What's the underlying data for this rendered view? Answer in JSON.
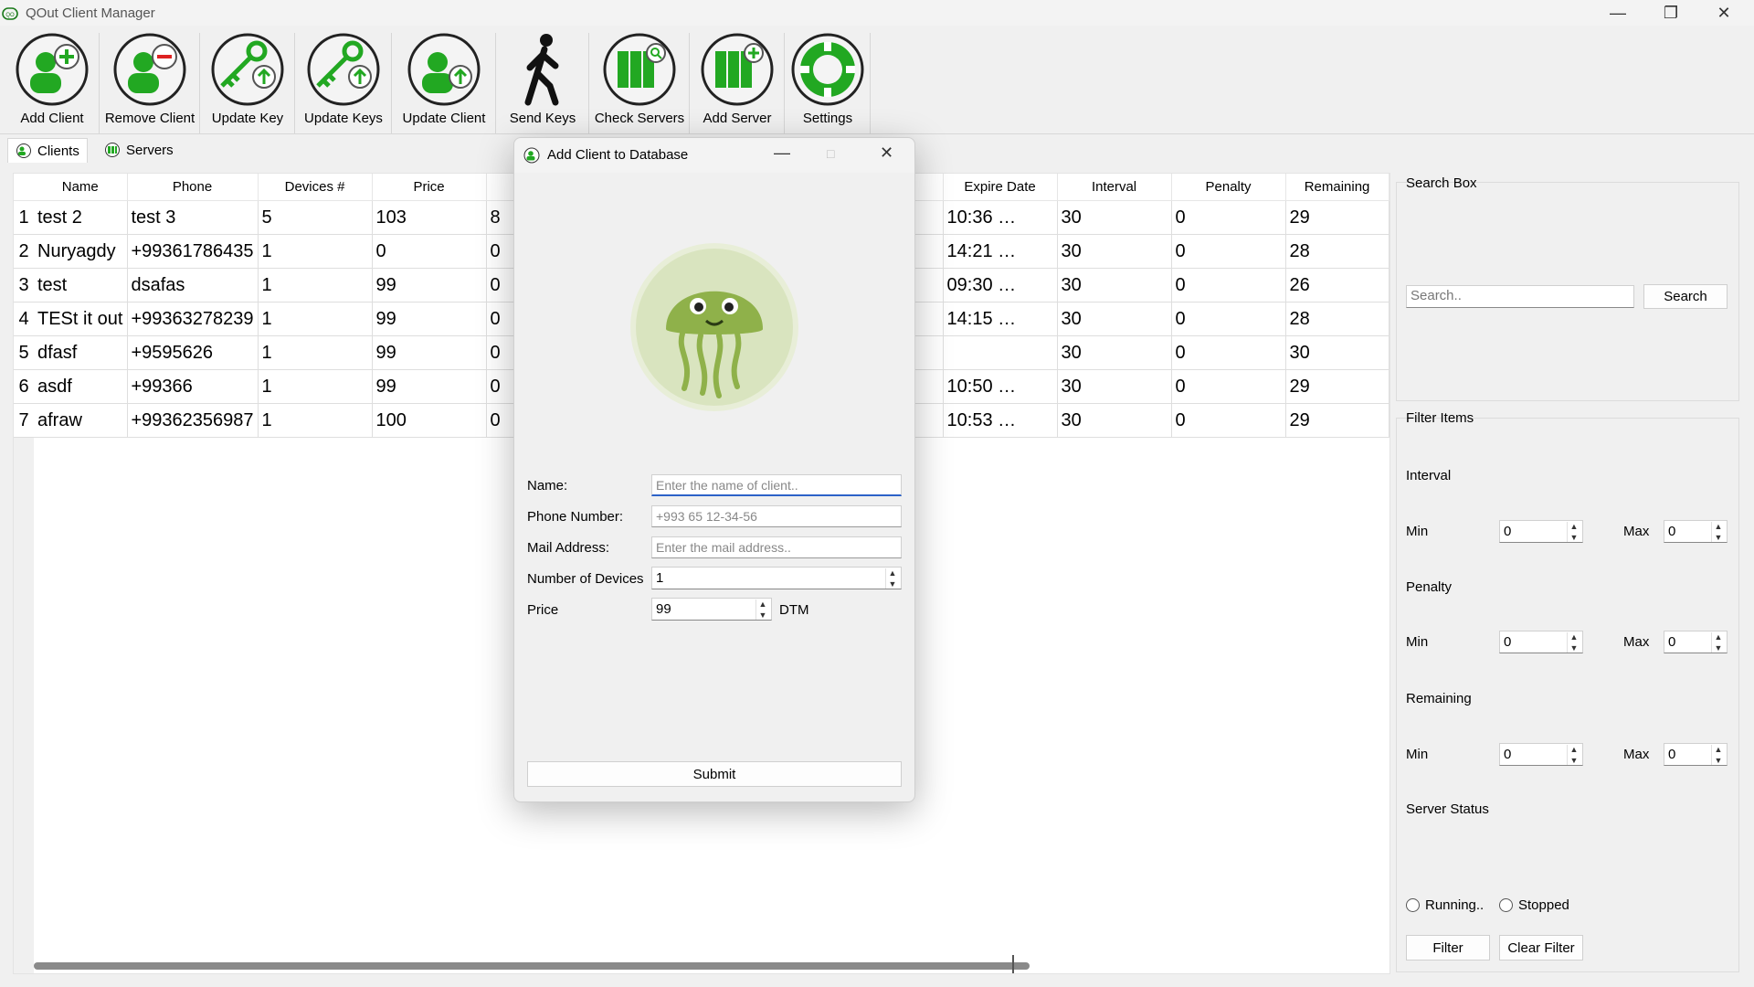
{
  "window": {
    "title": "QOut Client Manager"
  },
  "toolbar": [
    {
      "label": "Add Client",
      "icon": "add-client-icon"
    },
    {
      "label": "Remove Client",
      "icon": "remove-client-icon"
    },
    {
      "label": "Update Key",
      "icon": "update-key-icon"
    },
    {
      "label": "Update Keys",
      "icon": "update-keys-icon"
    },
    {
      "label": "Update Client",
      "icon": "update-client-icon"
    },
    {
      "label": "Send Keys",
      "icon": "walking-person-icon"
    },
    {
      "label": "Check Servers",
      "icon": "check-servers-icon"
    },
    {
      "label": "Add Server",
      "icon": "add-server-icon"
    },
    {
      "label": "Settings",
      "icon": "lifebuoy-icon"
    }
  ],
  "tabs": [
    {
      "label": "Clients",
      "active": true
    },
    {
      "label": "Servers",
      "active": false
    }
  ],
  "table": {
    "columns": [
      "Name",
      "Phone",
      "Devices #",
      "Price",
      "",
      "",
      "",
      "",
      "Expire Date",
      "Interval",
      "Penalty",
      "Remaining"
    ],
    "rows": [
      {
        "n": "1",
        "name": "test 2",
        "phone": "test 3",
        "devices": "5",
        "price": "103",
        "c5": "8",
        "expire": "10:36 …",
        "interval": "30",
        "penalty": "0",
        "remaining": "29"
      },
      {
        "n": "2",
        "name": "Nuryagdy",
        "phone": "+99361786435",
        "devices": "1",
        "price": "0",
        "c5": "0",
        "expire": "14:21 …",
        "interval": "30",
        "penalty": "0",
        "remaining": "28"
      },
      {
        "n": "3",
        "name": "test",
        "phone": "dsafas",
        "devices": "1",
        "price": "99",
        "c5": "0",
        "expire": "09:30 …",
        "interval": "30",
        "penalty": "0",
        "remaining": "26"
      },
      {
        "n": "4",
        "name": "TESt it out",
        "phone": "+99363278239",
        "devices": "1",
        "price": "99",
        "c5": "0",
        "expire": "14:15 …",
        "interval": "30",
        "penalty": "0",
        "remaining": "28"
      },
      {
        "n": "5",
        "name": "dfasf",
        "phone": "+9595626",
        "devices": "1",
        "price": "99",
        "c5": "0",
        "expire": "",
        "interval": "30",
        "penalty": "0",
        "remaining": "30"
      },
      {
        "n": "6",
        "name": "asdf",
        "phone": "+99366",
        "devices": "1",
        "price": "99",
        "c5": "0",
        "expire": "10:50 …",
        "interval": "30",
        "penalty": "0",
        "remaining": "29"
      },
      {
        "n": "7",
        "name": "afraw",
        "phone": "+99362356987",
        "devices": "1",
        "price": "100",
        "c5": "0",
        "expire": "10:53 …",
        "interval": "30",
        "penalty": "0",
        "remaining": "29"
      }
    ]
  },
  "search_box": {
    "title": "Search Box",
    "placeholder": "Search..",
    "button": "Search"
  },
  "filter": {
    "title": "Filter Items",
    "interval": {
      "label": "Interval",
      "min_label": "Min",
      "min": "0",
      "max_label": "Max",
      "max": "0"
    },
    "penalty": {
      "label": "Penalty",
      "min_label": "Min",
      "min": "0",
      "max_label": "Max",
      "max": "0"
    },
    "remaining": {
      "label": "Remaining",
      "min_label": "Min",
      "min": "0",
      "max_label": "Max",
      "max": "0"
    },
    "server_status": {
      "label": "Server Status",
      "running": "Running..",
      "stopped": "Stopped"
    },
    "filter_button": "Filter",
    "clear_button": "Clear Filter"
  },
  "dialog": {
    "title": "Add Client to Database",
    "name_label": "Name:",
    "name_placeholder": "Enter the name of client..",
    "phone_label": "Phone Number:",
    "phone_placeholder": "+993 65 12-34-56",
    "mail_label": "Mail Address:",
    "mail_placeholder": "Enter the mail address..",
    "devices_label": "Number of Devices",
    "devices_value": "1",
    "price_label": "Price",
    "price_value": "99",
    "currency": "DTM",
    "submit": "Submit"
  },
  "colors": {
    "accent_green": "#22a822",
    "dark_green": "#1b7a1b",
    "jelly_green": "#8fb14a",
    "focus_blue": "#2c62c8"
  }
}
